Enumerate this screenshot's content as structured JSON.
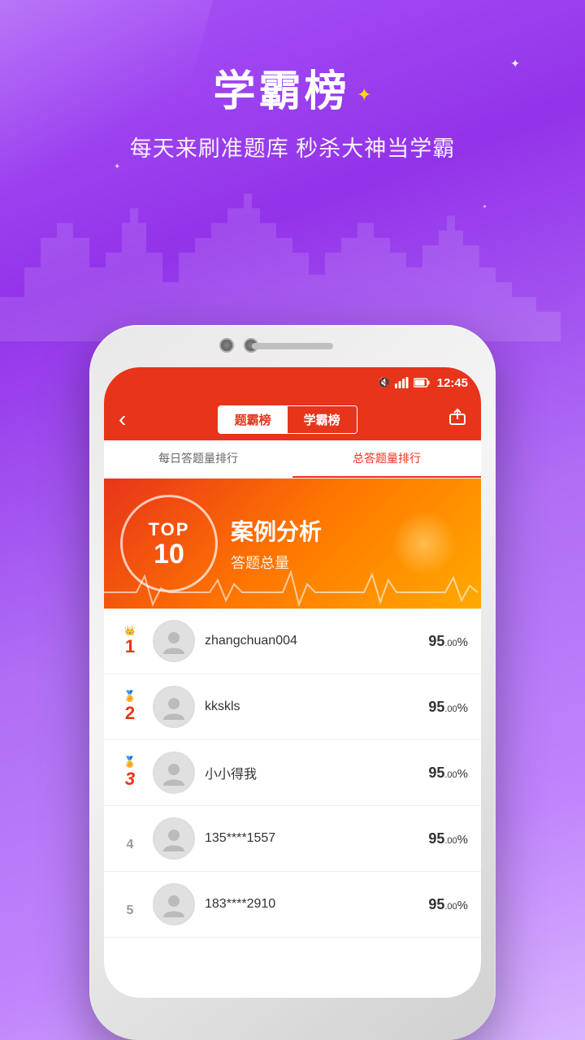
{
  "header": {
    "title": "学霸榜",
    "subtitle": "每天来刷准题库 秒杀大神当学霸",
    "sparkle": "✦"
  },
  "status_bar": {
    "time": "12:45",
    "signal_icon": "signal",
    "battery_icon": "battery",
    "mute_icon": "mute"
  },
  "nav": {
    "tab1": "题霸榜",
    "tab2": "学霸榜",
    "back_icon": "‹",
    "share_icon": "share"
  },
  "sub_tabs": {
    "tab1": "每日答题量排行",
    "tab2": "总答题量排行"
  },
  "banner": {
    "top_text": "TOP",
    "num_text": "10",
    "case_title": "案例分析",
    "case_sub": "答题总量"
  },
  "leaderboard": {
    "items": [
      {
        "rank": "1",
        "crown": "👑",
        "name": "zhangchuan004",
        "score_main": "95",
        "score_decimal": ".00",
        "score_unit": "%"
      },
      {
        "rank": "2",
        "crown": "🏅",
        "name": "kkskls",
        "score_main": "95",
        "score_decimal": ".00",
        "score_unit": "%"
      },
      {
        "rank": "3",
        "crown": "🏅",
        "name": "小小得我",
        "score_main": "95",
        "score_decimal": ".00",
        "score_unit": "%"
      },
      {
        "rank": "4",
        "crown": "",
        "name": "135****1557",
        "score_main": "95",
        "score_decimal": ".00",
        "score_unit": "%"
      },
      {
        "rank": "5",
        "crown": "",
        "name": "183****2910",
        "score_main": "95",
        "score_decimal": ".00",
        "score_unit": "%"
      }
    ]
  }
}
